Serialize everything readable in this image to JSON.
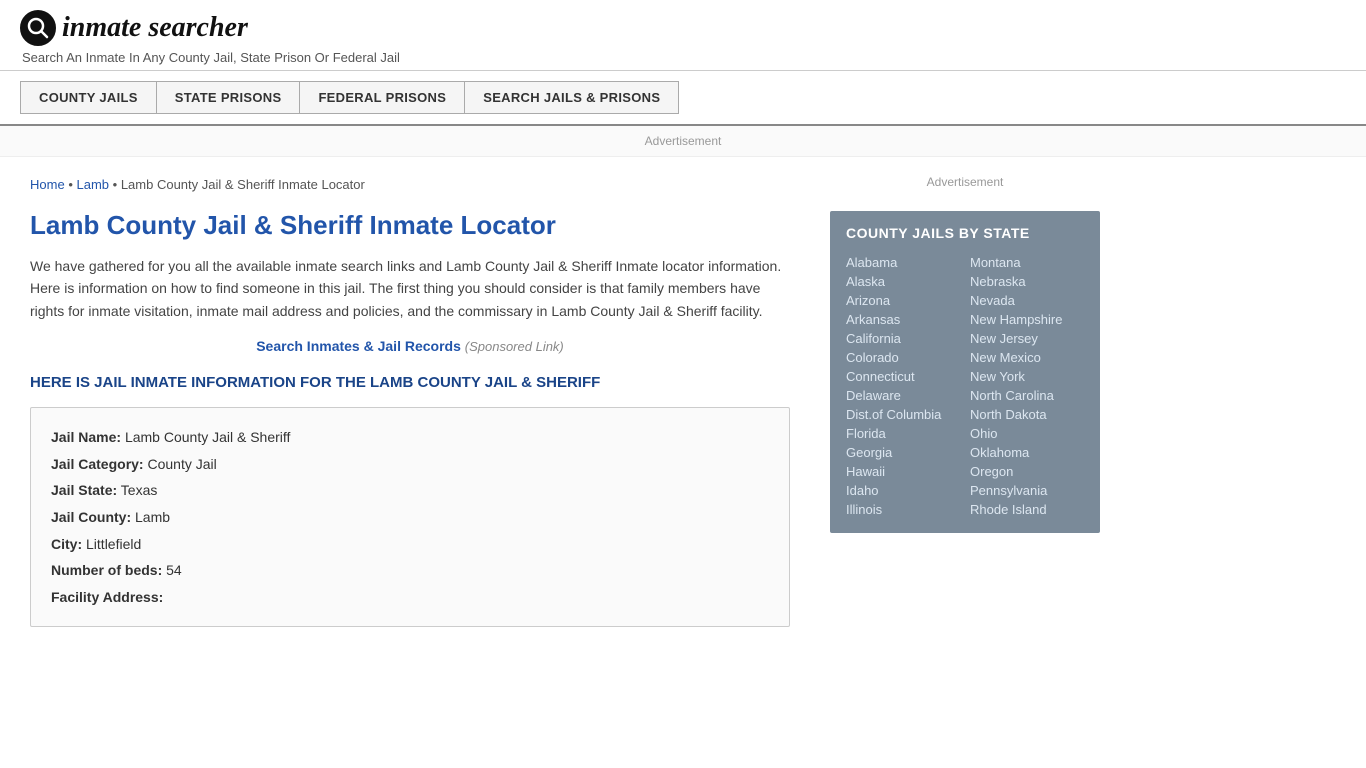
{
  "header": {
    "logo_text": "inmate searcher",
    "tagline": "Search An Inmate In Any County Jail, State Prison Or Federal Jail"
  },
  "nav": {
    "items": [
      {
        "label": "COUNTY JAILS",
        "name": "county-jails"
      },
      {
        "label": "STATE PRISONS",
        "name": "state-prisons"
      },
      {
        "label": "FEDERAL PRISONS",
        "name": "federal-prisons"
      },
      {
        "label": "SEARCH JAILS & PRISONS",
        "name": "search-jails-prisons"
      }
    ]
  },
  "ad": {
    "label": "Advertisement"
  },
  "breadcrumb": {
    "home": "Home",
    "separator": "•",
    "parent": "Lamb",
    "current": "Lamb County Jail & Sheriff Inmate Locator"
  },
  "page": {
    "title": "Lamb County Jail & Sheriff Inmate Locator",
    "description": "We have gathered for you all the available inmate search links and Lamb County Jail & Sheriff Inmate locator information. Here is information on how to find someone in this jail. The first thing you should consider is that family members have rights for inmate visitation, inmate mail address and policies, and the commissary in Lamb County Jail & Sheriff facility.",
    "sponsored_link_text": "Search Inmates & Jail Records",
    "sponsored_label": "(Sponsored Link)",
    "section_heading": "HERE IS JAIL INMATE INFORMATION FOR THE LAMB COUNTY JAIL & SHERIFF"
  },
  "info": {
    "jail_name_label": "Jail Name:",
    "jail_name_value": "Lamb County Jail & Sheriff",
    "jail_category_label": "Jail Category:",
    "jail_category_value": "County Jail",
    "jail_state_label": "Jail State:",
    "jail_state_value": "Texas",
    "jail_county_label": "Jail County:",
    "jail_county_value": "Lamb",
    "city_label": "City:",
    "city_value": "Littlefield",
    "beds_label": "Number of beds:",
    "beds_value": "54",
    "address_label": "Facility Address:"
  },
  "sidebar": {
    "ad_label": "Advertisement",
    "county_jails_heading": "COUNTY JAILS BY STATE",
    "states_col1": [
      "Alabama",
      "Alaska",
      "Arizona",
      "Arkansas",
      "California",
      "Colorado",
      "Connecticut",
      "Delaware",
      "Dist.of Columbia",
      "Florida",
      "Georgia",
      "Hawaii",
      "Idaho",
      "Illinois"
    ],
    "states_col2": [
      "Montana",
      "Nebraska",
      "Nevada",
      "New Hampshire",
      "New Jersey",
      "New Mexico",
      "New York",
      "North Carolina",
      "North Dakota",
      "Ohio",
      "Oklahoma",
      "Oregon",
      "Pennsylvania",
      "Rhode Island"
    ]
  }
}
